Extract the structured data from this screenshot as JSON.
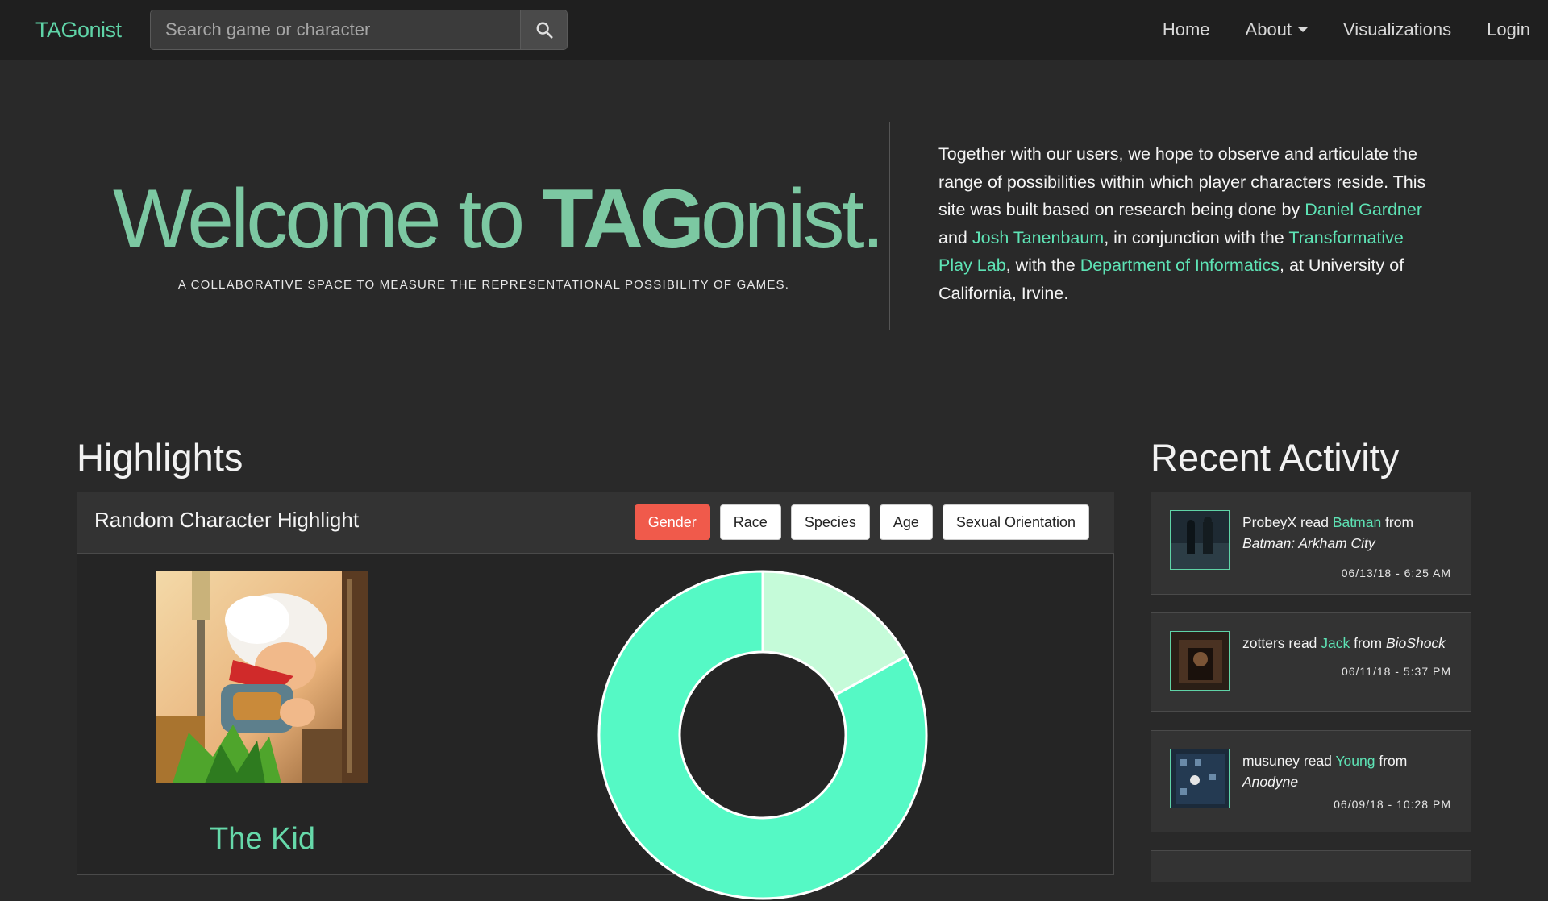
{
  "navbar": {
    "brand": "TAGonist",
    "search_placeholder": "Search game or character",
    "links": [
      "Home",
      "About",
      "Visualizations",
      "Login"
    ]
  },
  "hero": {
    "title_prefix": "Welcome to ",
    "title_bold": "TAG",
    "title_suffix": "onist.",
    "subtitle": "A COLLABORATIVE SPACE TO MEASURE THE REPRESENTATIONAL POSSIBILITY OF GAMES.",
    "text_1": "Together with our users, we hope to observe and articulate the range of possibilities within which player characters reside. This site was built based on research being done by ",
    "link_1": "Daniel Gardner",
    "text_2": " and ",
    "link_2": "Josh Tanenbaum",
    "text_3": ", in conjunction with the ",
    "link_3": "Transformative Play Lab",
    "text_4": ", with the ",
    "link_4": "Department of Informatics",
    "text_5": ", at University of California, Irvine."
  },
  "highlights": {
    "title": "Highlights",
    "panel_title": "Random Character Highlight",
    "filters": [
      "Gender",
      "Race",
      "Species",
      "Age",
      "Sexual Orientation"
    ],
    "active_filter": "Gender",
    "character_name": "The Kid"
  },
  "chart_data": {
    "type": "pie",
    "values": [
      17,
      83
    ],
    "colors": [
      "#c5fbd9",
      "#55f9c5"
    ]
  },
  "activity": {
    "title": "Recent Activity",
    "items": [
      {
        "user": "ProbeyX",
        "verb": " read ",
        "character": "Batman",
        "from": " from ",
        "game": "Batman: Arkham City",
        "time": "06/13/18 - 6:25 AM"
      },
      {
        "user": "zotters",
        "verb": " read ",
        "character": "Jack",
        "from": " from ",
        "game": "BioShock",
        "time": "06/11/18 - 5:37 PM"
      },
      {
        "user": "musuney",
        "verb": " read ",
        "character": "Young",
        "from": " from ",
        "game": "Anodyne",
        "time": "06/09/18 - 10:28 PM"
      }
    ]
  },
  "colors": {
    "accent": "#5fd3a7",
    "link": "#5ee3b5",
    "active_filter": "#f05a4b",
    "background": "#292929"
  }
}
